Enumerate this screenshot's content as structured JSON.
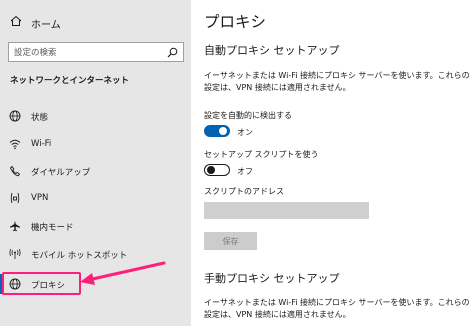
{
  "sidebar": {
    "home_label": "ホーム",
    "search_placeholder": "設定の検索",
    "section_title": "ネットワークとインターネット",
    "items": [
      {
        "label": "状態",
        "icon": "globe-icon"
      },
      {
        "label": "Wi-Fi",
        "icon": "wifi-icon"
      },
      {
        "label": "ダイヤルアップ",
        "icon": "phone-icon"
      },
      {
        "label": "VPN",
        "icon": "vpn-icon"
      },
      {
        "label": "機内モード",
        "icon": "airplane-icon"
      },
      {
        "label": "モバイル ホットスポット",
        "icon": "hotspot-icon"
      },
      {
        "label": "プロキシ",
        "icon": "globe-icon",
        "selected": true
      }
    ]
  },
  "main": {
    "title": "プロキシ",
    "auto": {
      "heading": "自動プロキシ セットアップ",
      "description": "イーサネットまたは Wi-Fi 接続にプロキシ サーバーを使います。これらの設定は、VPN 接続には適用されません。",
      "detect_label": "設定を自動的に検出する",
      "detect_state": "オン",
      "detect_on": true,
      "script_label": "セットアップ スクリプトを使う",
      "script_state": "オフ",
      "script_on": false,
      "address_label": "スクリプトのアドレス",
      "address_value": "",
      "save_label": "保存"
    },
    "manual": {
      "heading": "手動プロキシ セットアップ",
      "description": "イーサネットまたは Wi-Fi 接続にプロキシ サーバーを使います。これらの設定は、VPN 接続には適用されません。"
    }
  },
  "colors": {
    "sidebar_bg": "#e6e6e6",
    "accent": "#0067c0",
    "toggle_on": "#0063b1",
    "annotation": "#ff1e7a"
  }
}
